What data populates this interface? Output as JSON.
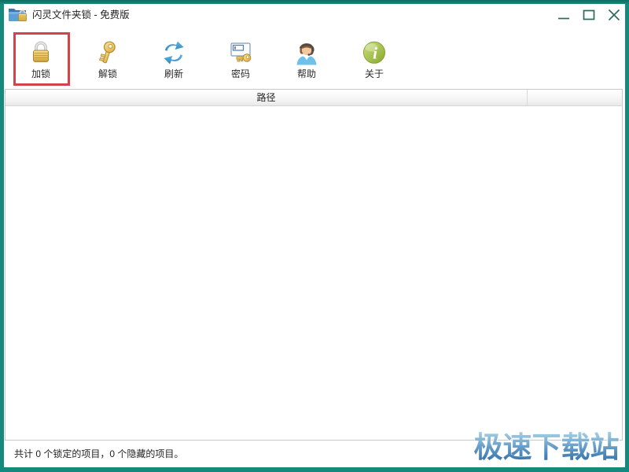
{
  "window": {
    "title": "闪灵文件夹锁 - 免费版"
  },
  "toolbar": {
    "buttons": [
      {
        "label": "加锁",
        "icon": "lock-icon",
        "highlighted": true
      },
      {
        "label": "解锁",
        "icon": "key-icon",
        "highlighted": false
      },
      {
        "label": "刷新",
        "icon": "refresh-icon",
        "highlighted": false
      },
      {
        "label": "密码",
        "icon": "password-key-icon",
        "highlighted": false
      },
      {
        "label": "帮助",
        "icon": "support-agent-icon",
        "highlighted": false
      },
      {
        "label": "关于",
        "icon": "info-icon",
        "highlighted": false
      }
    ],
    "about_glyph": "i"
  },
  "list": {
    "columns": [
      {
        "label": "路径"
      },
      {
        "label": ""
      }
    ],
    "rows": []
  },
  "statusbar": {
    "text": "共计 0 个锁定的项目，0 个隐藏的项目。"
  },
  "watermark": {
    "text": "极速下载站"
  },
  "colors": {
    "frame_teal": "#15897b",
    "annotation_highlight": "#d2434b",
    "watermark_top": "#aad2e6",
    "watermark_bottom": "#2f6ea8",
    "gold": "#e2b74e",
    "refresh_blue": "#3d9ad0",
    "about_green": "#9ab33a"
  }
}
